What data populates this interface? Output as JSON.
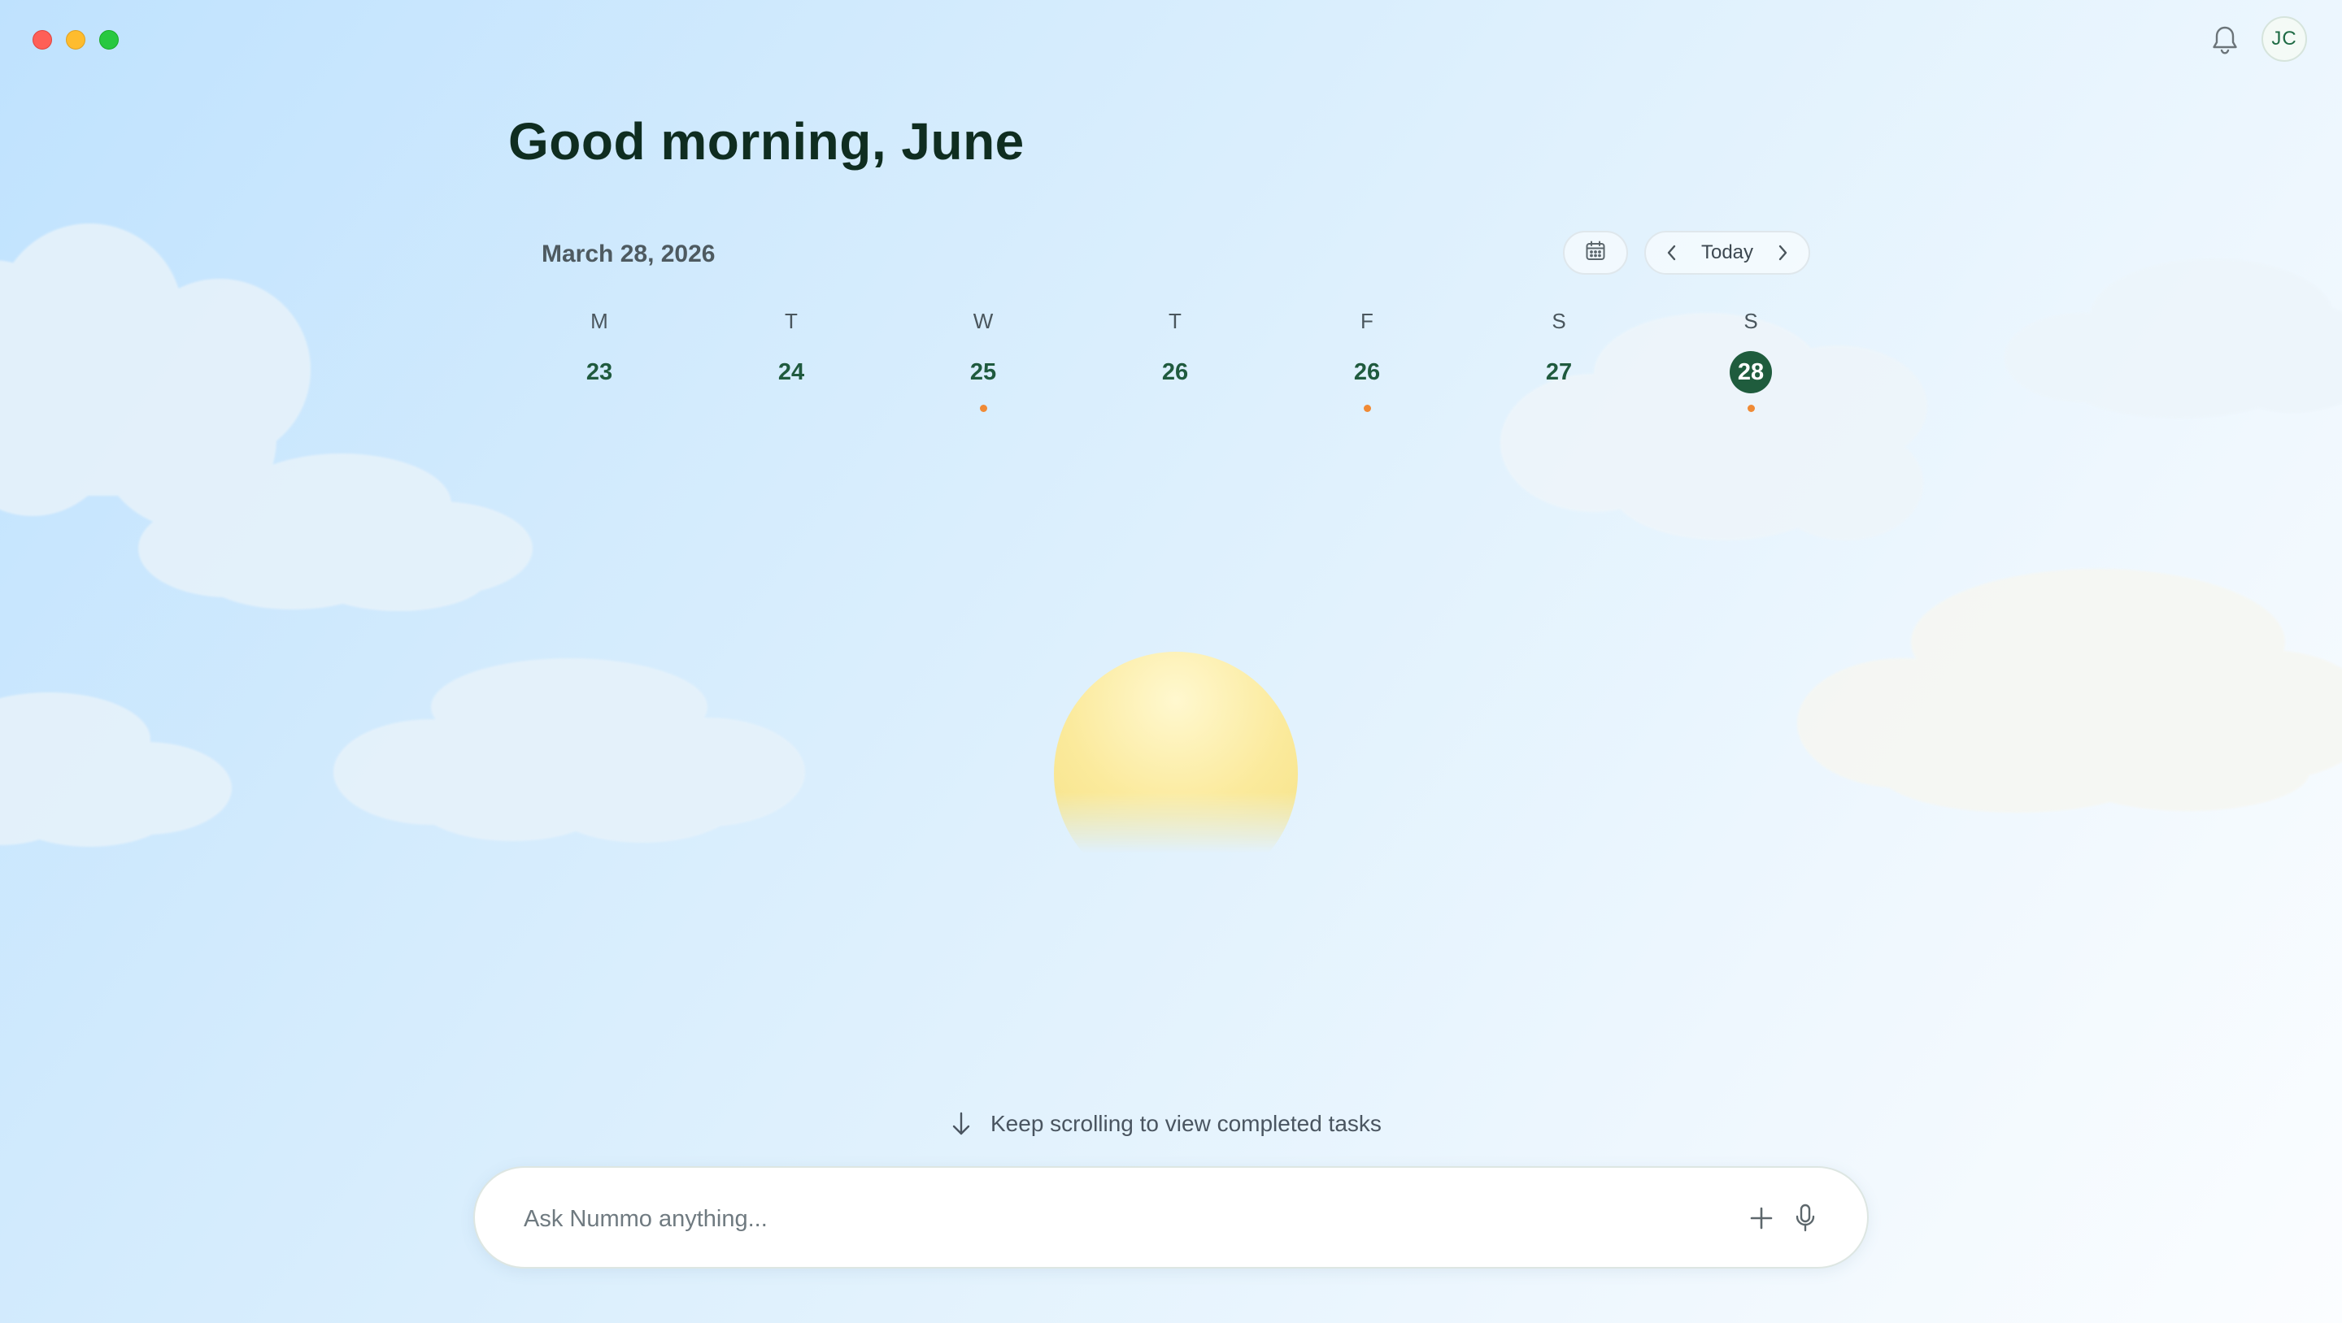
{
  "window": {
    "controls": [
      "close",
      "minimize",
      "maximize"
    ]
  },
  "header": {
    "notification_icon": "bell-icon",
    "avatar_initials": "JC"
  },
  "greeting": "Good morning, June",
  "calendar": {
    "current_date": "March 28, 2026",
    "calendar_icon": "calendar-icon",
    "today_label": "Today",
    "prev_icon": "chevron-left-icon",
    "next_icon": "chevron-right-icon",
    "week": [
      {
        "dow": "M",
        "date": "23",
        "has_event": false,
        "selected": false
      },
      {
        "dow": "T",
        "date": "24",
        "has_event": false,
        "selected": false
      },
      {
        "dow": "W",
        "date": "25",
        "has_event": true,
        "selected": false
      },
      {
        "dow": "T",
        "date": "26",
        "has_event": false,
        "selected": false
      },
      {
        "dow": "F",
        "date": "26",
        "has_event": true,
        "selected": false
      },
      {
        "dow": "S",
        "date": "27",
        "has_event": false,
        "selected": false
      },
      {
        "dow": "S",
        "date": "28",
        "has_event": true,
        "selected": true
      }
    ]
  },
  "scroll_hint": {
    "icon": "arrow-down-icon",
    "text": "Keep scrolling to view completed tasks"
  },
  "ask_bar": {
    "placeholder": "Ask Nummo anything...",
    "value": "",
    "plus_icon": "plus-icon",
    "mic_icon": "microphone-icon"
  },
  "colors": {
    "accent_green": "#1f5c3d",
    "event_dot": "#f08a35",
    "greeting_text": "#0f2d20"
  }
}
